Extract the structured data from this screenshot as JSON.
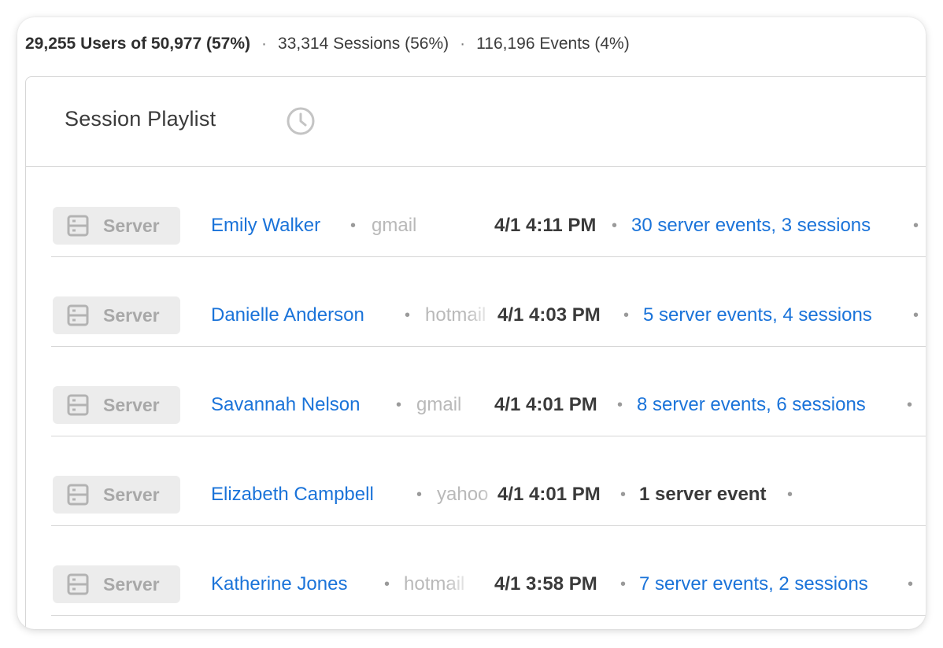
{
  "summary": {
    "users": "29,255 Users of 50,977 (57%)",
    "sessions": "33,314 Sessions (56%)",
    "events": "116,196 Events (4%)"
  },
  "playlist": {
    "title": "Session Playlist",
    "icon": "clock-icon"
  },
  "rows": [
    {
      "badge": "Server",
      "name": "Emily Walker",
      "domain": "gmail",
      "time": "4/1 4:11 PM",
      "events": "30 server events, 3 sessions",
      "linked": true
    },
    {
      "badge": "Server",
      "name": "Danielle Anderson",
      "domain": "hotmail",
      "time": "4/1 4:03 PM",
      "events": "5 server events, 4 sessions",
      "linked": true
    },
    {
      "badge": "Server",
      "name": "Savannah Nelson",
      "domain": "gmail",
      "time": "4/1 4:01 PM",
      "events": "8 server events, 6 sessions",
      "linked": true
    },
    {
      "badge": "Server",
      "name": "Elizabeth Campbell",
      "domain": "yahoo",
      "time": "4/1 4:01 PM",
      "events": "1 server event",
      "linked": false
    },
    {
      "badge": "Server",
      "name": "Katherine Jones",
      "domain": "hotmail",
      "time": "4/1 3:58 PM",
      "events": "7 server events, 2 sessions",
      "linked": true
    }
  ],
  "colors": {
    "link": "#1a73d9",
    "badge_bg": "#ececec",
    "border": "#d6d6d6"
  }
}
